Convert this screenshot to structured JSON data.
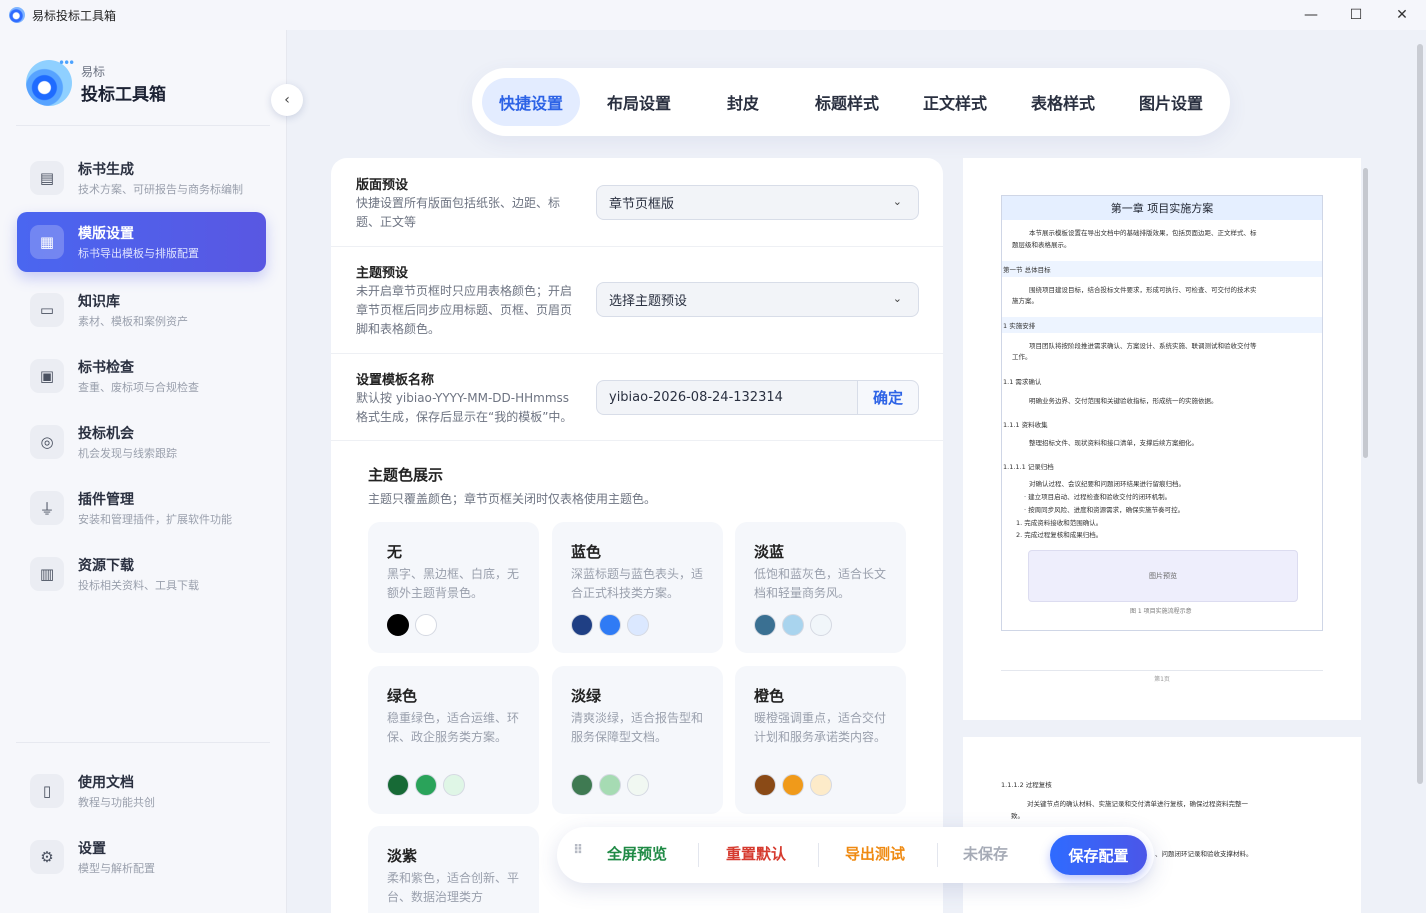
{
  "window": {
    "title": "易标投标工具箱",
    "controls": {
      "minimize": "—",
      "maximize": "☐",
      "close": "✕"
    }
  },
  "brand": {
    "small": "易标",
    "big": "投标工具箱"
  },
  "sidebar": {
    "collapse_icon": "chevron-left-icon",
    "items": [
      {
        "label": "标书生成",
        "sub": "技术方案、可研报告与商务标编制",
        "icon": "document-icon",
        "active": false
      },
      {
        "label": "模版设置",
        "sub": "标书导出模板与排版配置",
        "icon": "template-icon",
        "active": true
      },
      {
        "label": "知识库",
        "sub": "素材、模板和案例资产",
        "icon": "archive-icon",
        "active": false
      },
      {
        "label": "标书检查",
        "sub": "查重、废标项与合规检查",
        "icon": "check-document-icon",
        "active": false
      },
      {
        "label": "投标机会",
        "sub": "机会发现与线索跟踪",
        "icon": "target-icon",
        "active": false
      },
      {
        "label": "插件管理",
        "sub": "安装和管理插件，扩展软件功能",
        "icon": "plug-icon",
        "active": false
      },
      {
        "label": "资源下载",
        "sub": "投标相关资料、工具下载",
        "icon": "books-icon",
        "active": false
      }
    ],
    "bottom_items": [
      {
        "label": "使用文档",
        "sub": "教程与功能共创",
        "icon": "book-icon"
      },
      {
        "label": "设置",
        "sub": "模型与解析配置",
        "icon": "gear-icon"
      }
    ]
  },
  "tabs": [
    {
      "label": "快捷设置",
      "active": true
    },
    {
      "label": "布局设置",
      "active": false
    },
    {
      "label": "封皮",
      "active": false
    },
    {
      "label": "标题样式",
      "active": false
    },
    {
      "label": "正文样式",
      "active": false
    },
    {
      "label": "表格样式",
      "active": false
    },
    {
      "label": "图片设置",
      "active": false
    }
  ],
  "settings": {
    "layout_preset": {
      "title": "版面预设",
      "desc": "快捷设置所有版面包括纸张、边距、标题、正文等",
      "value": "章节页框版"
    },
    "theme_preset": {
      "title": "主题预设",
      "desc": "未开启章节页框时只应用表格颜色；开启章节页框后同步应用标题、页框、页眉页脚和表格颜色。",
      "value": "选择主题预设"
    },
    "template_name": {
      "title": "设置模板名称",
      "desc": "默认按 yibiao-YYYY-MM-DD-HHmmss 格式生成，保存后显示在“我的模板”中。",
      "value": "yibiao-2026-08-24-132314",
      "confirm": "确定"
    }
  },
  "theme_section": {
    "title": "主题色展示",
    "desc": "主题只覆盖颜色；章节页框关闭时仅表格使用主题色。",
    "themes": [
      {
        "name": "无",
        "desc": "黑字、黑边框、白底，无额外主题背景色。",
        "colors": [
          "#000000",
          "#ffffff"
        ]
      },
      {
        "name": "蓝色",
        "desc": "深蓝标题与蓝色表头，适合正式科技类方案。",
        "colors": [
          "#1f3f84",
          "#2f7bf5",
          "#dbe8ff"
        ]
      },
      {
        "name": "淡蓝",
        "desc": "低饱和蓝灰色，适合长文档和轻量商务风。",
        "colors": [
          "#3a7092",
          "#a9d4ee",
          "#f1f6fa"
        ]
      },
      {
        "name": "绿色",
        "desc": "稳重绿色，适合运维、环保、政企服务类方案。",
        "colors": [
          "#176a36",
          "#2aa35a",
          "#dff6e6"
        ]
      },
      {
        "name": "淡绿",
        "desc": "清爽淡绿，适合报告型和服务保障型文档。",
        "colors": [
          "#3f7a52",
          "#a6dbb3",
          "#f1f8f2"
        ]
      },
      {
        "name": "橙色",
        "desc": "暖橙强调重点，适合交付计划和服务承诺类内容。",
        "colors": [
          "#8a4a16",
          "#f09a1a",
          "#fdebc9"
        ]
      },
      {
        "name": "淡紫",
        "desc": "柔和紫色，适合创新、平台、数据治理类方",
        "colors": []
      }
    ]
  },
  "preview": {
    "chapter": "第一章 项目实施方案",
    "lines": [
      "本节展示模板设置在导出文档中的基础排版效果，包括页面边距、正文样式、标",
      "题层级和表格展示。",
      "第一节 总体目标",
      "围绕项目建设目标，结合投标文件要求，形成可执行、可检查、可交付的技术实",
      "施方案。",
      "1 实施安排",
      "项目团队将按阶段推进需求确认、方案设计、系统实施、联调测试和验收交付等",
      "工作。",
      "1.1 需求确认",
      "明确业务边界、交付范围和关键验收指标，形成统一的实施依据。",
      "1.1.1 资料收集",
      "整理招标文件、现状资料和接口清单，支撑后续方案细化。",
      "1.1.1.1 记录归档",
      "对确认过程、会议纪要和问题闭环结果进行留痕归档。",
      "· 建立项目启动、过程检查和验收交付的闭环机制。",
      "· 按周同步风险、进度和资源需求，确保实施节奏可控。",
      "1. 完成资料接收和范围确认。",
      "2. 完成过程复核和成果归档。"
    ],
    "image_label": "图片预览",
    "caption": "图 1 项目实施流程示意",
    "page": "第1页",
    "page2_lines": [
      "1.1.1.2 过程复核",
      "对关键节点的确认材料、实施记录和交付清单进行复核，确保过程资料完整一",
      "致。",
      "、问题闭环记录和验收支撑材料。"
    ]
  },
  "actions": {
    "drag_icon": "⠿",
    "fullscreen": "全屏预览",
    "reset": "重置默认",
    "export": "导出测试",
    "status": "未保存",
    "save": "保存配置",
    "colors": {
      "fullscreen": "#1f8a45",
      "reset": "#d63b2f",
      "export": "#ef8a12",
      "status": "#a6abb6"
    }
  }
}
